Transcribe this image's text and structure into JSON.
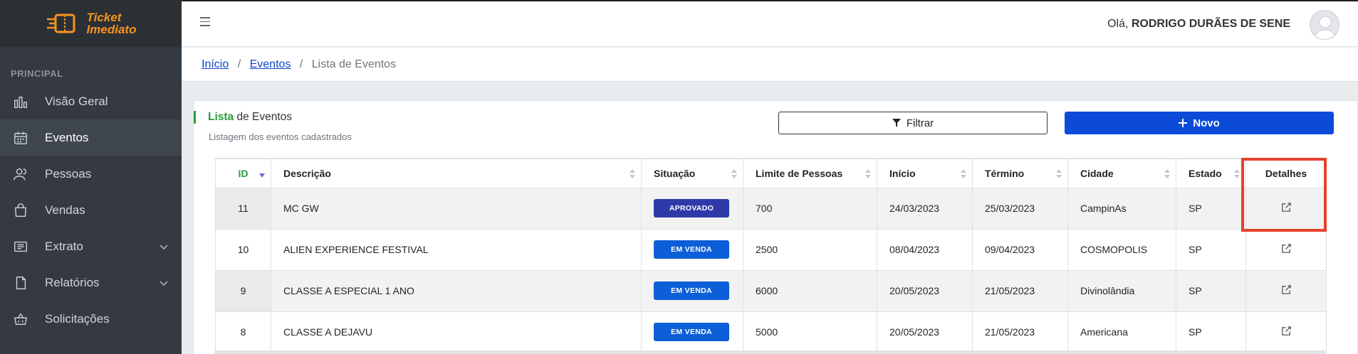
{
  "app": {
    "logo_line1": "Ticket",
    "logo_line2": "Imediato",
    "brand_color": "#f7931e"
  },
  "sidebar": {
    "section": "PRINCIPAL",
    "items": [
      {
        "label": "Visão Geral",
        "icon": "bar-chart-icon",
        "active": false
      },
      {
        "label": "Eventos",
        "icon": "calendar-icon",
        "active": true
      },
      {
        "label": "Pessoas",
        "icon": "users-icon",
        "active": false
      },
      {
        "label": "Vendas",
        "icon": "shopping-bag-icon",
        "active": false
      },
      {
        "label": "Extrato",
        "icon": "receipt-icon",
        "active": false,
        "expandable": true
      },
      {
        "label": "Relatórios",
        "icon": "document-icon",
        "active": false,
        "expandable": true
      },
      {
        "label": "Solicitações",
        "icon": "basket-icon",
        "active": false
      }
    ]
  },
  "header": {
    "greeting": "Olá,",
    "user_name": "RODRIGO DURÃES DE SENE"
  },
  "breadcrumb": {
    "home": "Início",
    "events": "Eventos",
    "current": "Lista de Eventos",
    "separator": "/"
  },
  "card": {
    "title_accent": "Lista",
    "title_rest": "de Eventos",
    "subtitle": "Listagem dos eventos cadastrados",
    "filter_label": "Filtrar",
    "new_label": "Novo"
  },
  "table": {
    "headers": {
      "id": "ID",
      "descricao": "Descrição",
      "situacao": "Situação",
      "limite": "Limite de Pessoas",
      "inicio": "Início",
      "termino": "Término",
      "cidade": "Cidade",
      "estado": "Estado",
      "detalhes": "Detalhes"
    },
    "rows": [
      {
        "id": "11",
        "descricao": "MC GW",
        "situacao": "APROVADO",
        "limite": "700",
        "inicio": "24/03/2023",
        "termino": "25/03/2023",
        "cidade": "CampinAs",
        "estado": "SP"
      },
      {
        "id": "10",
        "descricao": "ALIEN EXPERIENCE FESTIVAL",
        "situacao": "EM VENDA",
        "limite": "2500",
        "inicio": "08/04/2023",
        "termino": "09/04/2023",
        "cidade": "COSMOPOLIS",
        "estado": "SP"
      },
      {
        "id": "9",
        "descricao": "CLASSE A ESPECIAL 1 ANO",
        "situacao": "EM VENDA",
        "limite": "6000",
        "inicio": "20/05/2023",
        "termino": "21/05/2023",
        "cidade": "Divinolândia",
        "estado": "SP"
      },
      {
        "id": "8",
        "descricao": "CLASSE A DEJAVU",
        "situacao": "EM VENDA",
        "limite": "5000",
        "inicio": "20/05/2023",
        "termino": "21/05/2023",
        "cidade": "Americana",
        "estado": "SP"
      }
    ]
  },
  "colors": {
    "accent_green": "#2a9d3a",
    "primary_blue": "#0b4bd8",
    "badge_aprovado": "#2e3aa8",
    "badge_venda": "#0c5fd6",
    "highlight_red": "#e8412b"
  }
}
